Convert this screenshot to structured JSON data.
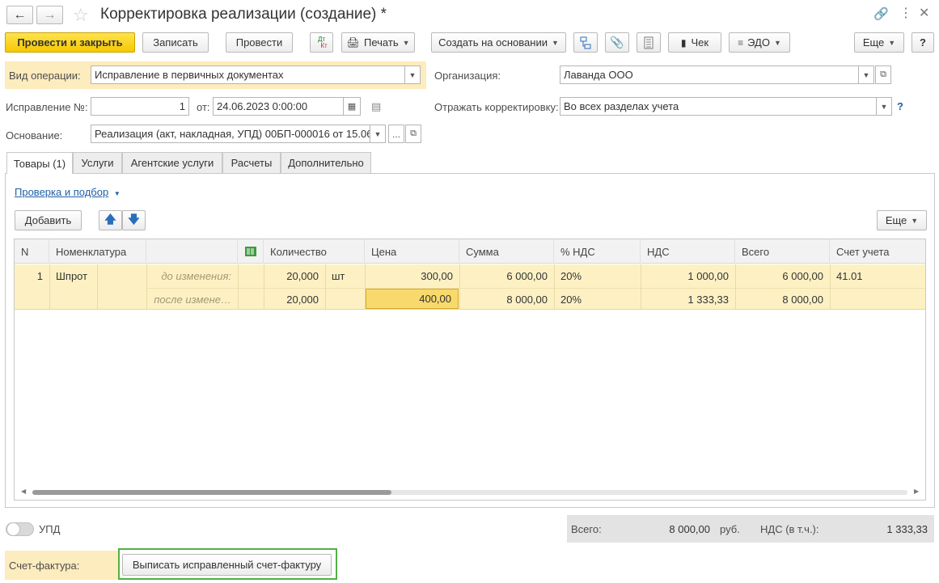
{
  "window": {
    "title": "Корректировка реализации (создание) *"
  },
  "toolbar": {
    "post_close": "Провести и закрыть",
    "save": "Записать",
    "post": "Провести",
    "dtkt_top": "Дт",
    "dtkt_bottom": "Кт",
    "print": "Печать",
    "create_based": "Создать на основании",
    "check": "Чек",
    "edo": "ЭДО",
    "more": "Еще",
    "help": "?"
  },
  "form": {
    "operation_label": "Вид операции:",
    "operation_value": "Исправление в первичных документах",
    "org_label": "Организация:",
    "org_value": "Лаванда ООО",
    "correction_label": "Исправление №:",
    "correction_value": "1",
    "from_label": "от:",
    "date_value": "24.06.2023  0:00:00",
    "reflect_label": "Отражать корректировку:",
    "reflect_value": "Во всех разделах учета",
    "reflect_help": "?",
    "basis_label": "Основание:",
    "basis_value": "Реализация (акт, накладная, УПД) 00БП-000016 от 15.06",
    "basis_dots": "..."
  },
  "tabs": [
    {
      "label": "Товары (1)",
      "active": true
    },
    {
      "label": "Услуги"
    },
    {
      "label": "Агентские услуги"
    },
    {
      "label": "Расчеты"
    },
    {
      "label": "Дополнительно"
    }
  ],
  "goods": {
    "check_link": "Проверка и подбор",
    "add": "Добавить",
    "more": "Еще",
    "columns": {
      "n": "N",
      "nomenclature": "Номенклатура",
      "qty": "Количество",
      "price": "Цена",
      "sum": "Сумма",
      "vat_rate": "% НДС",
      "vat": "НДС",
      "total": "Всего",
      "account": "Счет учета"
    },
    "rows": [
      {
        "n": "1",
        "item": "Шпрот",
        "unit": "шт",
        "account": "41.01",
        "before_label": "до изменения:",
        "before_qty": "20,000",
        "before_price": "300,00",
        "before_sum": "6 000,00",
        "before_rate": "20%",
        "before_vat": "1 000,00",
        "before_total": "6 000,00",
        "after_label": "после измене…",
        "after_qty": "20,000",
        "after_price": "400,00",
        "after_sum": "8 000,00",
        "after_rate": "20%",
        "after_vat": "1 333,33",
        "after_total": "8 000,00"
      }
    ]
  },
  "footer": {
    "upd_label": "УПД",
    "upd_on": false,
    "total_label": "Всего:",
    "total_value": "8 000,00",
    "currency": "руб.",
    "vat_label": "НДС (в т.ч.):",
    "vat_value": "1 333,33",
    "invoice_label": "Счет-фактура:",
    "invoice_button": "Выписать исправленный счет-фактуру"
  },
  "colors": {
    "accent_yellow": "#f5c800",
    "row_highlight": "#fdf1c4",
    "link_blue": "#1f5fa8",
    "invoice_border": "#52b043"
  }
}
